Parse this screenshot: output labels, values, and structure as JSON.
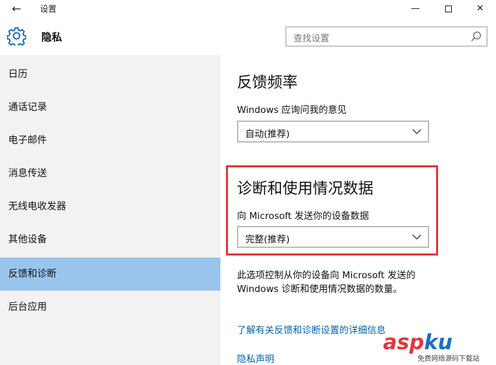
{
  "window": {
    "title": "设置",
    "back_icon": "←",
    "minimize_icon": "—",
    "close_icon": "✕"
  },
  "header": {
    "section_title": "隐私",
    "search_placeholder": "查找设置"
  },
  "sidebar": {
    "items": [
      {
        "label": "日历"
      },
      {
        "label": "通话记录"
      },
      {
        "label": "电子邮件"
      },
      {
        "label": "消息传送"
      },
      {
        "label": "无线电收发器"
      },
      {
        "label": "其他设备"
      },
      {
        "label": "反馈和诊断",
        "selected": true
      },
      {
        "label": "后台应用"
      }
    ],
    "selected_color": "#99c5ec"
  },
  "main": {
    "feedback": {
      "heading": "反馈频率",
      "label": "Windows 应询问我的意见",
      "value": "自动(推荐)"
    },
    "diagnostics": {
      "heading": "诊断和使用情况数据",
      "label": "向 Microsoft 发送你的设备数据",
      "value": "完整(推荐)",
      "highlight_color": "#e0393e"
    },
    "description_line1": "此选项控制从你的设备向 Microsoft 发送的",
    "description_line2": "Windows 诊断和使用情况数据的数量。",
    "link_details": "了解有关反馈和诊断设置的详细信息",
    "link_privacy": "隐私声明",
    "link_color": "#0063b1"
  },
  "watermark": {
    "brand": "aspku",
    "tagline": "免费网络源码下载站"
  }
}
